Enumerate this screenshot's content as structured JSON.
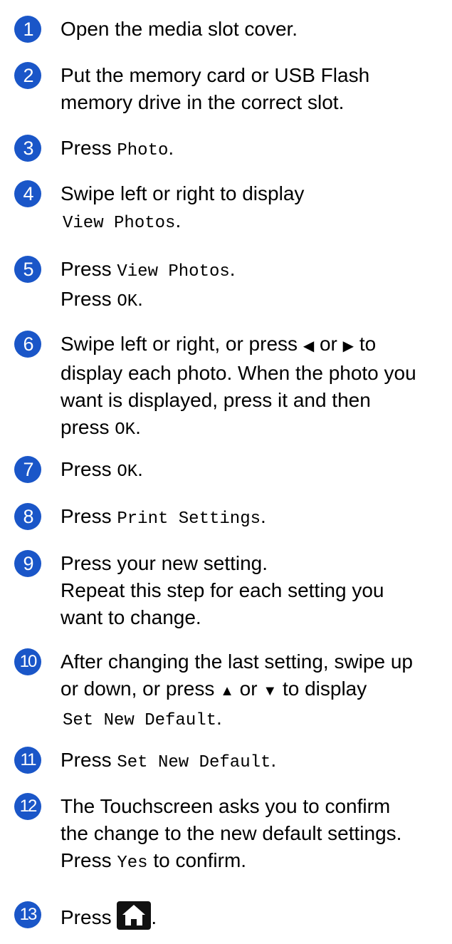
{
  "steps": [
    {
      "n": "1",
      "text": "Open the media slot cover."
    },
    {
      "n": "2",
      "line1": "Put the memory card or USB Flash",
      "line2": "memory drive in the correct slot."
    },
    {
      "n": "3",
      "pre": "Press ",
      "code": "Photo",
      "post": "."
    },
    {
      "n": "4",
      "line1": "Swipe left or right to display",
      "code": "View Photos",
      "post": "."
    },
    {
      "n": "5",
      "pre": "Press ",
      "code": "View Photos",
      "post": ".",
      "pre2": "Press ",
      "code2": "OK",
      "post2": "."
    },
    {
      "n": "6",
      "line1a": "Swipe left or right, or press ",
      "arrow_left": "◀",
      "or": " or ",
      "arrow_right": "▶",
      "line1b": " to",
      "line2": "display each photo. When the photo you",
      "line3": "want is displayed, press it and then",
      "pre4": "press ",
      "code4": "OK",
      "post4": "."
    },
    {
      "n": "7",
      "pre": "Press ",
      "code": "OK",
      "post": "."
    },
    {
      "n": "8",
      "pre": "Press ",
      "code": "Print Settings",
      "post": "."
    },
    {
      "n": "9",
      "line1": "Press your new setting.",
      "line2": "Repeat this step for each setting you",
      "line3": "want to change."
    },
    {
      "n": "10",
      "line1": "After changing the last setting, swipe up",
      "line2a": "or down, or press ",
      "arrow_up": "▲",
      "or": " or ",
      "arrow_down": "▼",
      "line2b": " to display",
      "code": "Set New Default",
      "post": "."
    },
    {
      "n": "11",
      "pre": "Press ",
      "code": "Set New Default",
      "post": "."
    },
    {
      "n": "12",
      "line1": "The Touchscreen asks you to confirm",
      "line2": "the change to the new default settings.",
      "pre3": "Press ",
      "code3": "Yes",
      "post3": " to confirm."
    },
    {
      "n": "13",
      "pre": "Press ",
      "icon": "home-icon",
      "post": "."
    }
  ]
}
